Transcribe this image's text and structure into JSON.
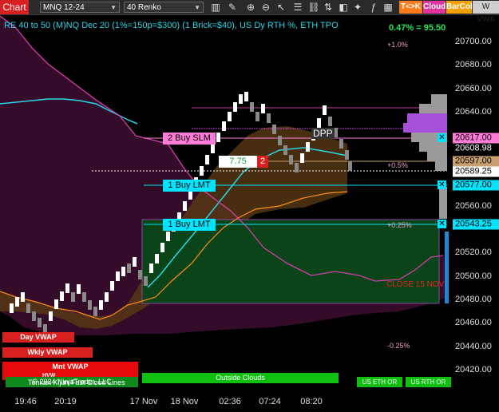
{
  "toolbar": {
    "chart_tab": "Chart",
    "instrument": "MNQ 12-24",
    "bar_type": "40 Renko",
    "t_k_label": "T<>K",
    "cloud_label": "Cloud",
    "barcol_label": "BarCol",
    "vwa_label": "W VWA"
  },
  "title": "RE 40 to 50 (M)NQ Dec 20 (1%=150p=$300) (1 Brick=$40), US Dy RTH %, ETH TPO",
  "pnl": "0.47% = 95.50",
  "price_axis": [
    "20700.00",
    "20680.00",
    "20660.00",
    "20640.00",
    "20560.00",
    "20520.00",
    "20500.00",
    "20480.00",
    "20460.00",
    "20440.00",
    "20420.00"
  ],
  "price_tags": {
    "p1": "20617.00",
    "p2": "20608.98",
    "p3": "20597.00",
    "p4": "20589.25",
    "p5": "20577.00",
    "p6": "20543.25"
  },
  "time_axis": [
    "19:46",
    "20:19",
    "17 Nov",
    "18 Nov",
    "02:36",
    "07:24",
    "08:20"
  ],
  "orders": {
    "buy_slm": "2 Buy SLM",
    "buy_lmt1": "1 Buy LMT",
    "buy_lmt2": "1 Buy LMT",
    "pos_value": "7.75",
    "pos_qty": "2",
    "dpp": "DPP"
  },
  "pct_labels": {
    "p1": "+1.0%",
    "p2": "+0.5%",
    "p3": "+0.25%",
    "p4": "-0.25%"
  },
  "close_label": "CLOSE 15 NOV",
  "vwap": {
    "day": "Day VWAP",
    "wkly": "Wkly VWAP",
    "mnt": "Mnt VWAP",
    "hvw": "HVW"
  },
  "bottom": {
    "copyright": "© 2024 NinjaTrader, LLC",
    "tenkan": "Tenkan Kijun Fast Cloud Lines",
    "outside": "Outside Clouds",
    "us_eth": "US ETH OR",
    "us_rth": "US RTH OR"
  },
  "colors": {
    "accent": "#29d6e6",
    "buy": "#00e5ff",
    "sell": "#ff7bd8",
    "profit": "#29e65a",
    "brand": "#d92020"
  }
}
